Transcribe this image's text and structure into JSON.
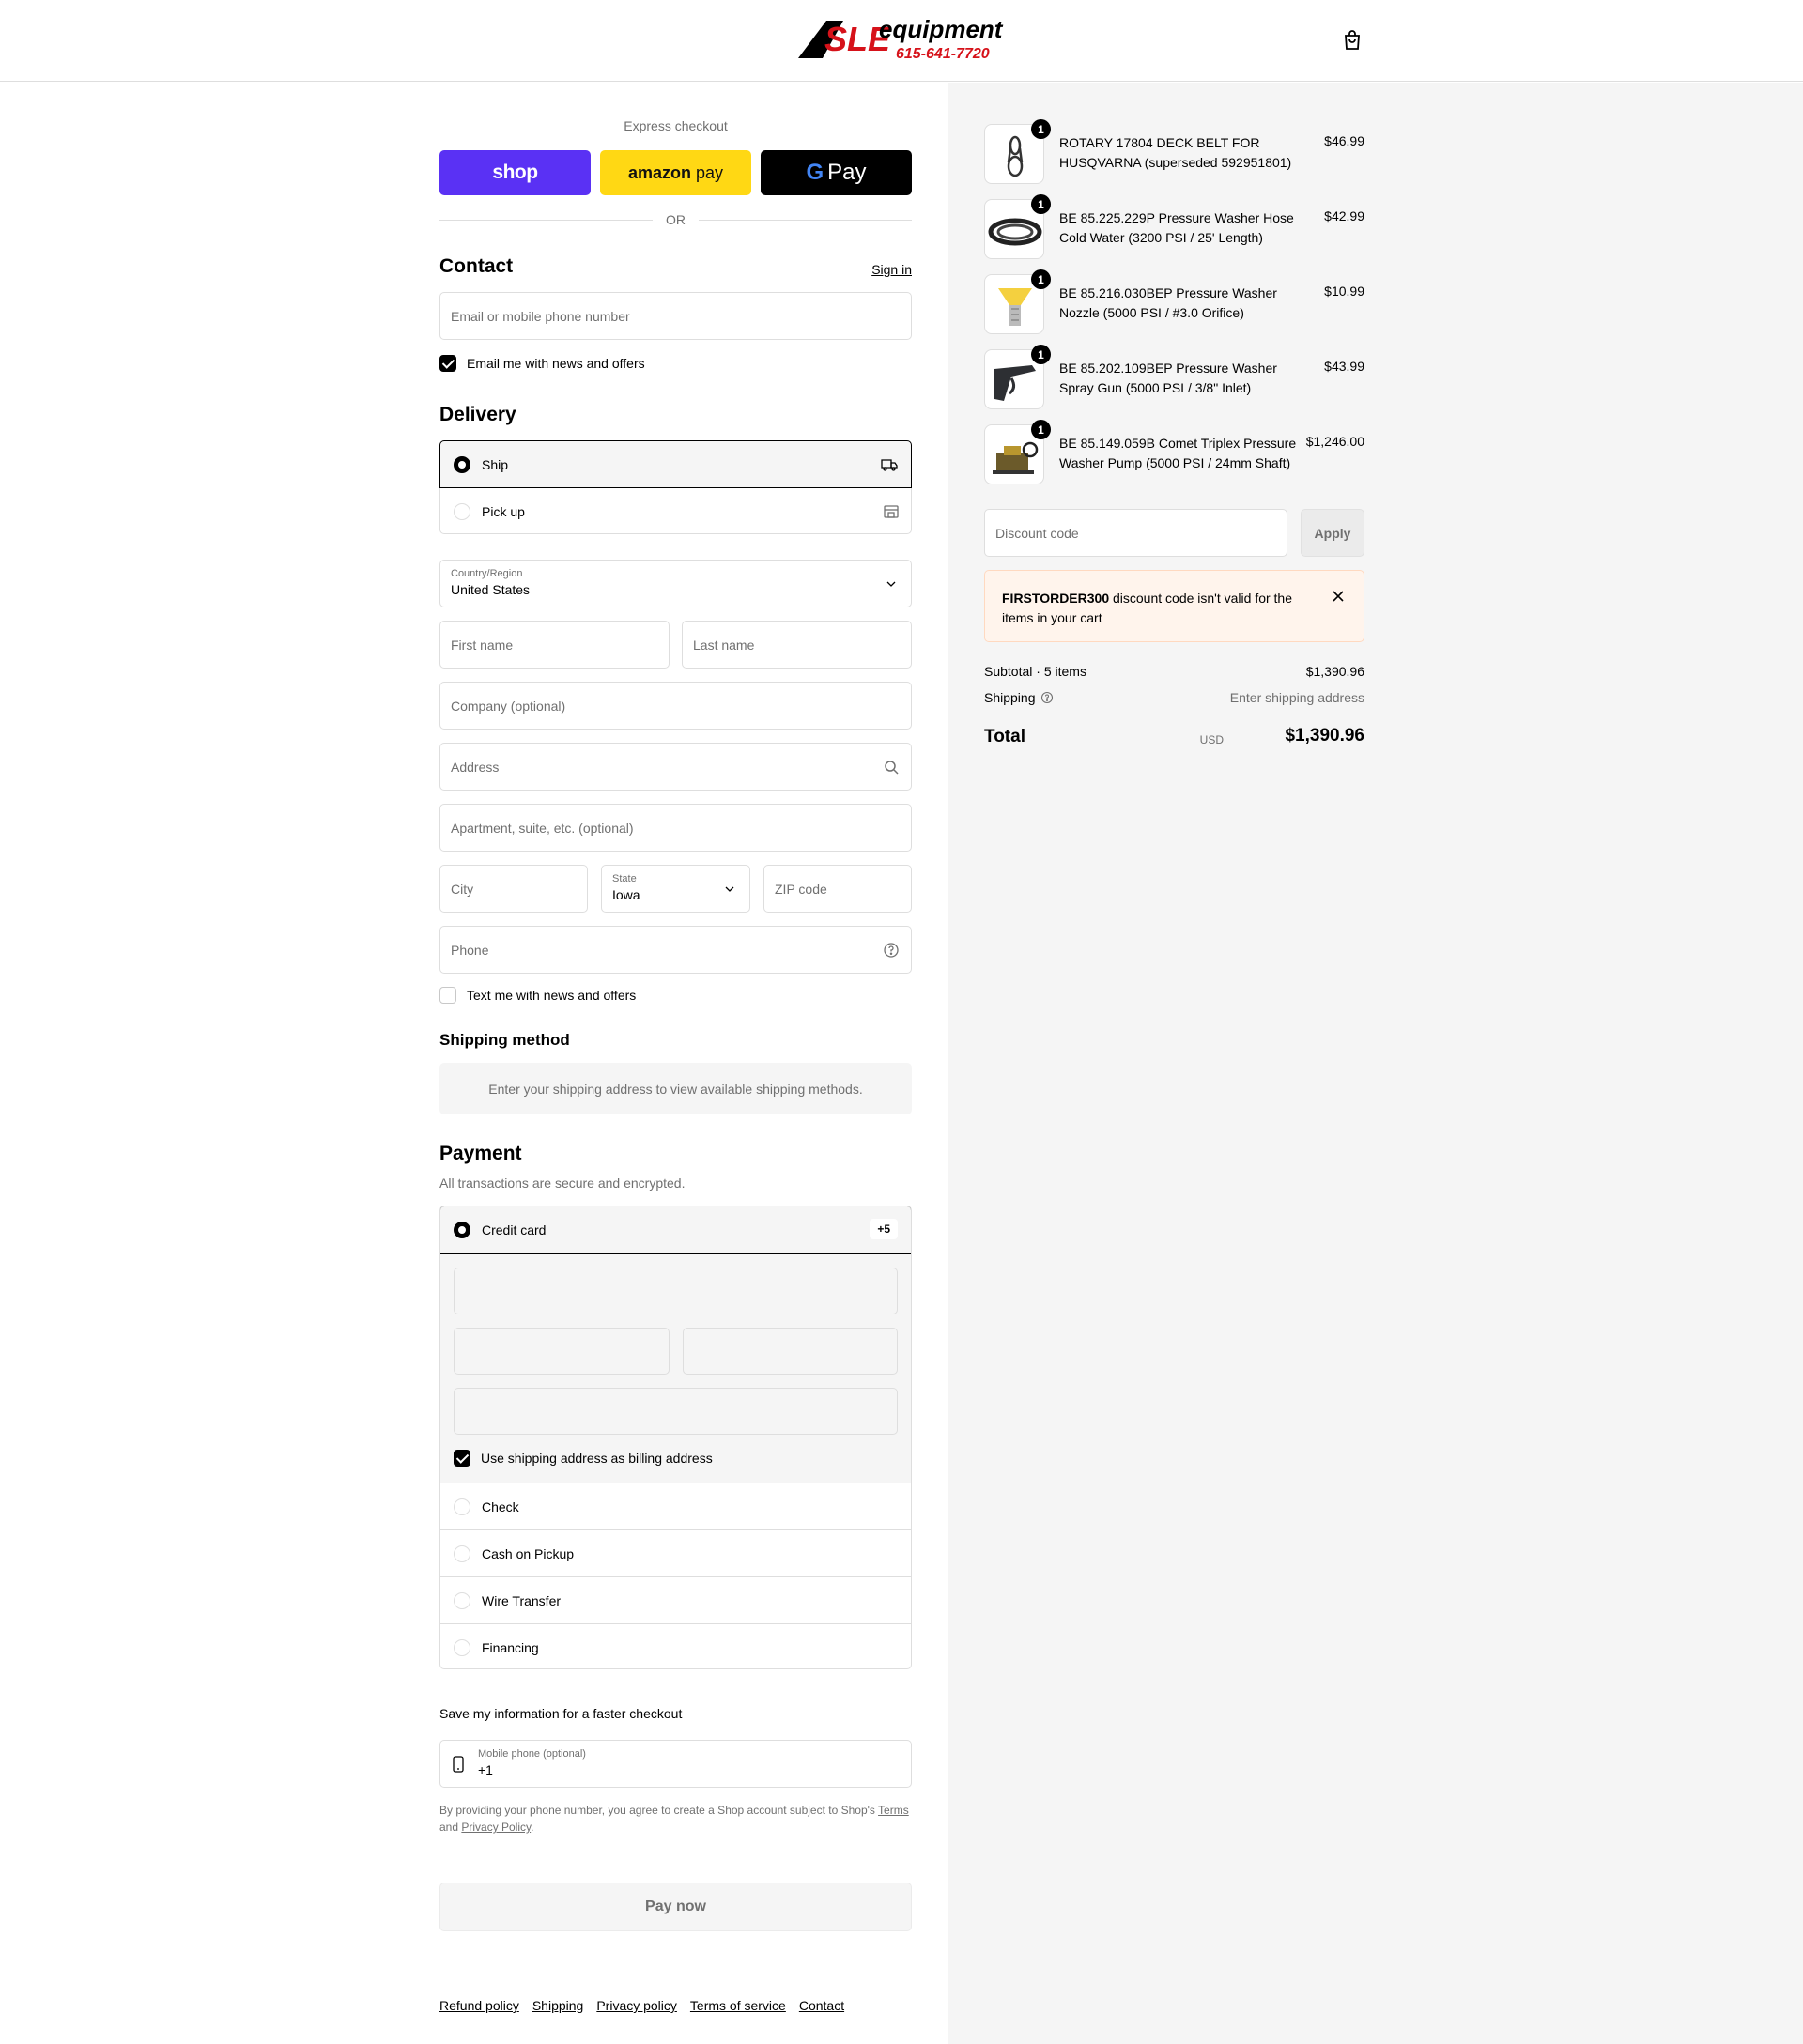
{
  "brand": {
    "logo_main": "SLE",
    "logo_sub": "equipment",
    "logo_phone": "615-641-7720"
  },
  "express": {
    "title": "Express checkout",
    "shop_label": "shop",
    "amazon_label_a": "amazon",
    "amazon_label_b": "pay",
    "gpay_label": "Pay",
    "or_label": "OR"
  },
  "contact": {
    "heading": "Contact",
    "signin": "Sign in",
    "email_placeholder": "Email or mobile phone number",
    "email_news_label": "Email me with news and offers",
    "email_news_checked": true
  },
  "delivery": {
    "heading": "Delivery",
    "options": [
      {
        "label": "Ship",
        "selected": true
      },
      {
        "label": "Pick up",
        "selected": false
      }
    ],
    "country_label": "Country/Region",
    "country_value": "United States",
    "first_name": "First name",
    "last_name": "Last name",
    "company": "Company (optional)",
    "address": "Address",
    "apartment": "Apartment, suite, etc. (optional)",
    "city": "City",
    "state_label": "State",
    "state_value": "Iowa",
    "zip": "ZIP code",
    "phone": "Phone",
    "text_news_label": "Text me with news and offers",
    "text_news_checked": false
  },
  "shipping_method": {
    "heading": "Shipping method",
    "message": "Enter your shipping address to view available shipping methods."
  },
  "payment": {
    "heading": "Payment",
    "subtitle": "All transactions are secure and encrypted.",
    "credit_card_label": "Credit card",
    "credit_card_badge": "+5",
    "billing_label": "Use shipping address as billing address",
    "billing_checked": true,
    "other_options": [
      "Check",
      "Cash on Pickup",
      "Wire Transfer",
      "Financing"
    ]
  },
  "save_info": {
    "heading": "Save my information for a faster checkout",
    "mobile_label": "Mobile phone (optional)",
    "mobile_value": "+1",
    "legal_a": "By providing your phone number, you agree to create a Shop account subject to Shop's ",
    "terms": "Terms",
    "legal_b": "and ",
    "privacy": "Privacy Policy",
    "legal_c": "."
  },
  "pay_now": "Pay now",
  "footer": [
    "Refund policy",
    "Shipping",
    "Privacy policy",
    "Terms of service",
    "Contact"
  ],
  "cart": {
    "items": [
      {
        "qty": "1",
        "name": "ROTARY 17804 DECK BELT FOR HUSQVARNA (superseded 592951801)",
        "price": "$46.99",
        "icon": "belt-icon"
      },
      {
        "qty": "1",
        "name": "BE 85.225.229P Pressure Washer Hose Cold Water (3200 PSI / 25' Length)",
        "price": "$42.99",
        "icon": "hose-icon"
      },
      {
        "qty": "1",
        "name": "BE 85.216.030BEP Pressure Washer Nozzle (5000 PSI / #3.0 Orifice)",
        "price": "$10.99",
        "icon": "nozzle-icon"
      },
      {
        "qty": "1",
        "name": "BE 85.202.109BEP Pressure Washer Spray Gun (5000 PSI / 3/8\" Inlet)",
        "price": "$43.99",
        "icon": "spray-gun-icon"
      },
      {
        "qty": "1",
        "name": "BE 85.149.059B Comet Triplex Pressure Washer Pump (5000 PSI / 24mm Shaft)",
        "price": "$1,246.00",
        "icon": "pump-icon"
      }
    ],
    "discount_placeholder": "Discount code",
    "apply_label": "Apply",
    "error_code": "FIRSTORDER300",
    "error_msg": " discount code isn't valid for the items in your cart",
    "subtotal_label": "Subtotal · 5 items",
    "subtotal_value": "$1,390.96",
    "shipping_label": "Shipping",
    "shipping_value": "Enter shipping address",
    "total_label": "Total",
    "total_currency": "USD",
    "total_value": "$1,390.96"
  }
}
